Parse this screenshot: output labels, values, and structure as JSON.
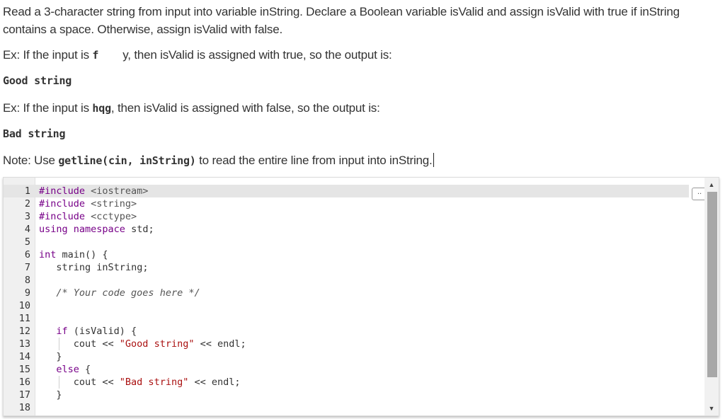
{
  "prompt": {
    "intro": "Read a 3-character string from input into variable inString. Declare a Boolean variable isValid and assign isValid with true if inString contains a space. Otherwise, assign isValid with false.",
    "ex1_prefix": "Ex: If the input is",
    "ex1_input_a": "f",
    "ex1_input_b": "y",
    "ex1_suffix": ", then isValid is assigned with true, so the output is:",
    "out1": "Good string",
    "ex2_prefix": "Ex: If the input is",
    "ex2_input": "hqg",
    "ex2_suffix": ", then isValid is assigned with false, so the output is:",
    "out2": "Bad string",
    "note_prefix": "Note: Use",
    "note_code": "getline(cin, inString)",
    "note_suffix": "to read the entire line from input into inString."
  },
  "editor": {
    "fold_label": "..",
    "lines": [
      {
        "n": "1",
        "text": "#include <iostream>"
      },
      {
        "n": "2",
        "text": "#include <string>"
      },
      {
        "n": "3",
        "text": "#include <cctype>"
      },
      {
        "n": "4",
        "text": "using namespace std;"
      },
      {
        "n": "5",
        "text": ""
      },
      {
        "n": "6",
        "text": "int main() {"
      },
      {
        "n": "7",
        "text": "   string inString;"
      },
      {
        "n": "8",
        "text": ""
      },
      {
        "n": "9",
        "text": "   /* Your code goes here */"
      },
      {
        "n": "10",
        "text": ""
      },
      {
        "n": "11",
        "text": ""
      },
      {
        "n": "12",
        "text": "   if (isValid) {"
      },
      {
        "n": "13",
        "text": "      cout << \"Good string\" << endl;"
      },
      {
        "n": "14",
        "text": "   }"
      },
      {
        "n": "15",
        "text": "   else {"
      },
      {
        "n": "16",
        "text": "      cout << \"Bad string\" << endl;"
      },
      {
        "n": "17",
        "text": "   }"
      },
      {
        "n": "18",
        "text": ""
      }
    ],
    "active_line": "1",
    "scroll_position": 0.0
  }
}
